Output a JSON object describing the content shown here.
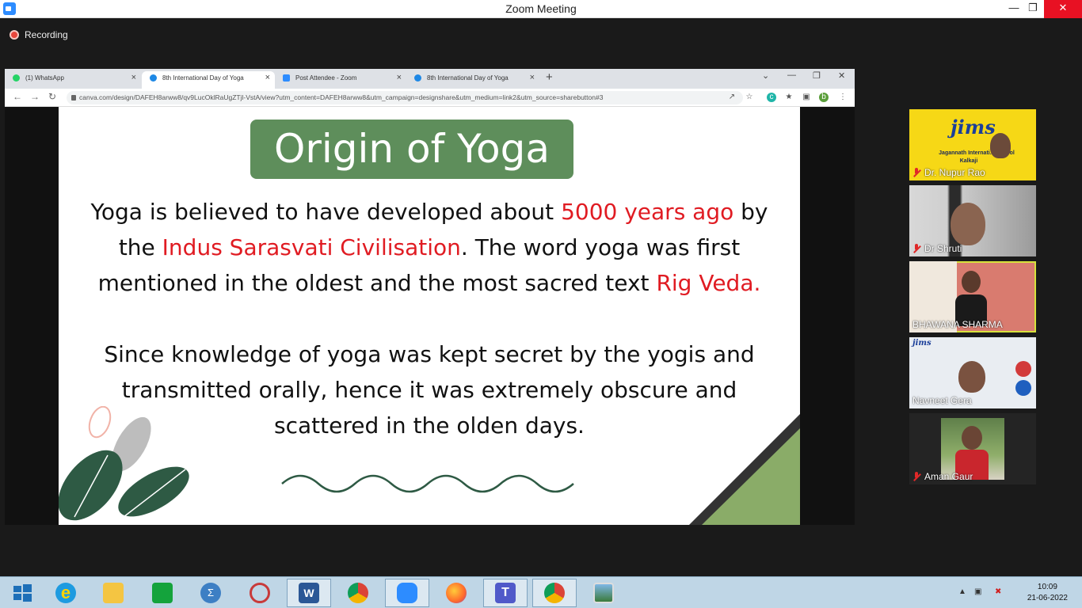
{
  "window": {
    "title": "Zoom Meeting"
  },
  "recording_label": "Recording",
  "browser": {
    "tabs": [
      {
        "label": "(1) WhatsApp",
        "favicon_color": "#25d366",
        "active": false
      },
      {
        "label": "8th International Day of Yoga",
        "favicon_color": "#1e88e5",
        "active": true
      },
      {
        "label": "Post Attendee - Zoom",
        "favicon_color": "#2d8cff",
        "active": false
      },
      {
        "label": "8th International Day of Yoga",
        "favicon_color": "#1e88e5",
        "active": false
      }
    ],
    "url": "canva.com/design/DAFEH8arww8/qv9LucOklRaUgZTjl-VstA/view?utm_content=DAFEH8arww8&utm_campaign=designshare&utm_medium=link2&utm_source=sharebutton#3",
    "profile_initial": "b"
  },
  "slide": {
    "title": "Origin of Yoga",
    "p1_a": "Yoga is believed to have developed about ",
    "p1_red1": "5000 years ago",
    "p1_b": " by the ",
    "p1_red2": "Indus Sarasvati Civilisation",
    "p1_c": ". The word yoga was first mentioned in the oldest and the most sacred text ",
    "p1_red3": "Rig Veda.",
    "p2": "Since knowledge of yoga was kept secret by the yogis and transmitted orally, hence it  was extremely obscure and scattered in the olden days.",
    "accent_green": "#5e8e5b",
    "accent_red": "#e01b22"
  },
  "participants": [
    {
      "name": "Dr. Nupur Rao",
      "muted": true,
      "logo_text": "jims",
      "caption_text": "Jagannath Internati... School",
      "caption2": "Kalkaji"
    },
    {
      "name": "Dr Shruti",
      "muted": true
    },
    {
      "name": "BHAWANA SHARMA",
      "muted": false,
      "speaking": true
    },
    {
      "name": "Navneet Gera",
      "muted": false,
      "logo_text": "jims"
    },
    {
      "name": "Aman Gaur",
      "muted": true
    }
  ],
  "taskbar": {
    "time": "10:09",
    "date": "21-06-2022",
    "apps": [
      "start",
      "internet-explorer",
      "file-explorer",
      "store",
      "calculator",
      "snipping-tool",
      "word",
      "chrome",
      "zoom",
      "firefox",
      "teams",
      "chrome-profile",
      "photos"
    ]
  }
}
